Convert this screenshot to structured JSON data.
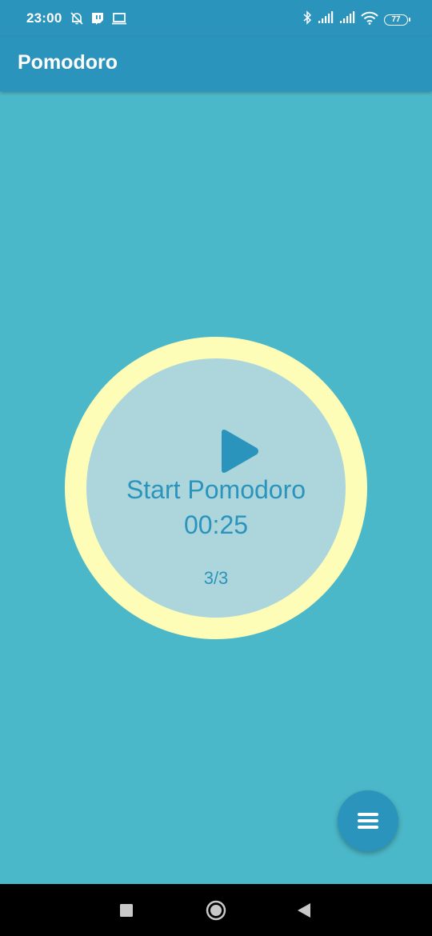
{
  "status_bar": {
    "time": "23:00",
    "left_icons": [
      "bell-off-icon",
      "twitch-icon",
      "laptop-icon"
    ],
    "right_icons": [
      "bluetooth-icon",
      "signal-icon",
      "signal-icon",
      "wifi-icon"
    ],
    "battery": "77"
  },
  "app_bar": {
    "title": "Pomodoro"
  },
  "timer": {
    "label": "Start Pomodoro",
    "time": "00:25",
    "count": "3/3",
    "icon": "play-icon"
  },
  "fab": {
    "icon": "menu-icon"
  },
  "nav_bar": {
    "buttons": [
      "recents-icon",
      "home-icon",
      "back-icon"
    ]
  },
  "colors": {
    "background": "#4bb8c9",
    "primary": "#2b94bc",
    "ring": "#fdfdb7",
    "inner_circle": "#acd6dc"
  }
}
